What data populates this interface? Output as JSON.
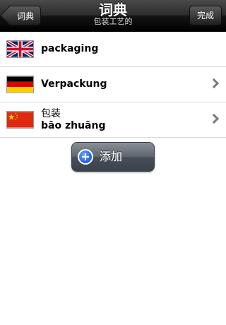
{
  "navbar": {
    "title": "词典",
    "subtitle": "包装工艺的",
    "back_label": "词典",
    "done_label": "完成"
  },
  "entries": [
    {
      "flag_icon": "uk-flag-icon",
      "line1": "",
      "line2": "packaging",
      "has_chevron": false
    },
    {
      "flag_icon": "germany-flag-icon",
      "line1": "",
      "line2": "Verpackung",
      "has_chevron": true
    },
    {
      "flag_icon": "china-flag-icon",
      "line1": "包装",
      "line2": "bāo zhuāng",
      "has_chevron": true
    }
  ],
  "add_button": {
    "label": "添加",
    "icon": "plus-circle-icon"
  }
}
